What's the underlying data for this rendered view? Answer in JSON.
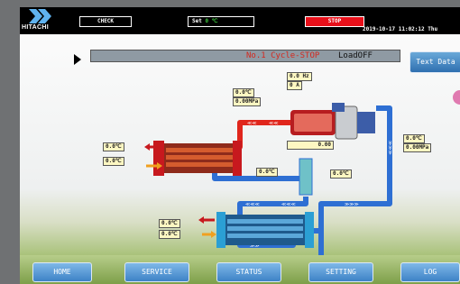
{
  "header": {
    "brand": "HITACHI",
    "check_label": "CHECK",
    "set_label": "Set",
    "set_value": "0",
    "set_unit": "℃",
    "stop_label": "STOP",
    "datetime": "2019-10-17 11:02:12 Thu"
  },
  "status": {
    "cycle_text": "No.1 Cycle-STOP",
    "load_text": "LoadOFF"
  },
  "buttons": {
    "text_data": "Text Data"
  },
  "readings": {
    "compressor_hz": "0.0 Hz",
    "compressor_a": "0    A",
    "discharge_temp": "0.0℃",
    "discharge_pressure": "0.00MPa",
    "suction_temp": "0.0℃",
    "suction_pressure": "0.00MPa",
    "valve_opening": "0.00",
    "condenser_in_temp": "0.0℃",
    "condenser_out_temp": "0.0℃",
    "pipe_temp_left": "0.0℃",
    "pipe_temp_right": "0.0℃",
    "evaporator_in_temp": "0.0℃",
    "evaporator_out_temp": "0.0℃"
  },
  "nav": {
    "items": [
      "HOME",
      "SERVICE",
      "STATUS",
      "SETTING",
      "LOG"
    ]
  },
  "colors": {
    "hot_pipe": "#e0261c",
    "cold_pipe": "#2e6fd3",
    "stop_red": "#e8101a",
    "value_bg": "#fdf7c2",
    "nav_button": "#3d82c6"
  }
}
